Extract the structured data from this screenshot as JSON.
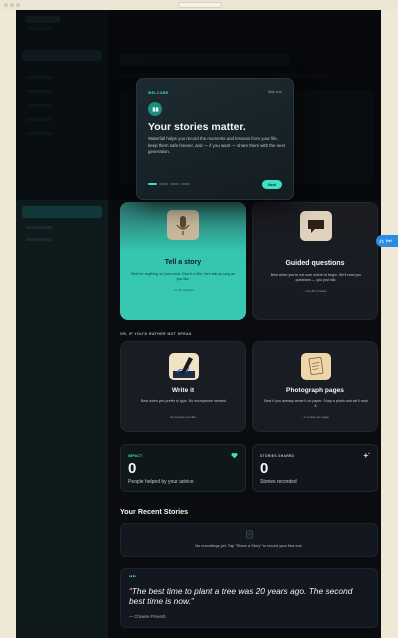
{
  "onboarding": {
    "kicker": "WELCOME",
    "skip_label": "Skip tour",
    "title": "Your stories matter.",
    "body": "Waterfall helps you record the moments and lessons from your life, keep them safe forever, and — if you want — share them with the next generation.",
    "next_label": "Next",
    "step_count": 4,
    "current_step": 1
  },
  "record_options": [
    {
      "title": "Tell a story",
      "description": "Best for anything on your mind. Give it a title, then talk as long as you like.",
      "time": "~ 5–10 minutes"
    },
    {
      "title": "Guided questions",
      "description": "Best when you're not sure where to begin. We'll read you questions — you just talk.",
      "time": "~ 10–30 minutes"
    }
  ],
  "alt_section_label": "OR, IF YOU'D RATHER NOT SPEAK",
  "alt_options": [
    {
      "title": "Write it",
      "description": "Best when you prefer to type. No microphone needed.",
      "time": "As long as you like"
    },
    {
      "title": "Photograph pages",
      "description": "Best if you already wrote it on paper. Snap a photo and we'll read it.",
      "time": "~ 1 minute per page"
    }
  ],
  "stats": {
    "impact": {
      "kicker": "IMPACT",
      "value": "0",
      "caption": "People helped by your advice"
    },
    "shared": {
      "kicker": "STORIES SHARED",
      "value": "0",
      "caption": "Stories recorded"
    }
  },
  "recent": {
    "title": "Your Recent Stories",
    "empty_text": "No recordings yet. Tap \"Share a Story\" to record your first one."
  },
  "quote": {
    "mark": "““",
    "text": "“The best time to plant a tree was 20 years ago. The second best time is now.”",
    "author": "— Chinese Proverb"
  },
  "help": {
    "label": "Hel"
  },
  "colors": {
    "accent": "#3fe0c5",
    "background": "#0a0c10",
    "help": "#2a8de0"
  }
}
